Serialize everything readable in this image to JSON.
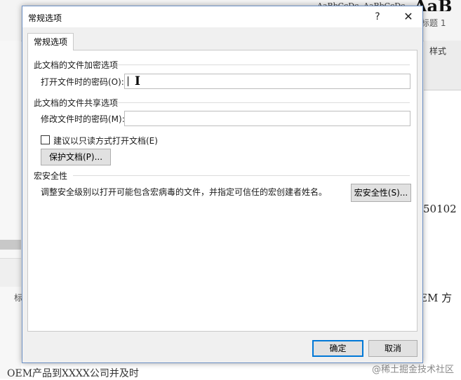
{
  "background": {
    "style_samples": [
      "AaBbCcDc",
      "AaBbCcDc",
      "AaB"
    ],
    "heading1": "标题 1",
    "styles_label": "样式",
    "doc_number": "50102",
    "doc_em_text": "EM 方",
    "left_label": "标",
    "bottom_text": "OEM产品到XXXX公司并及时",
    "watermark": "@稀土掘金技术社区"
  },
  "dialog": {
    "title": "常规选项",
    "help_glyph": "?",
    "close_glyph": "✕",
    "tab": "常规选项",
    "encrypt_section": "此文档的文件加密选项",
    "open_password_label": "打开文件时的密码(O):",
    "open_password_value": "",
    "share_section": "此文档的文件共享选项",
    "modify_password_label": "修改文件时的密码(M):",
    "modify_password_value": "",
    "readonly_checkbox_label": "建议以只读方式打开文档(E)",
    "readonly_checked": false,
    "protect_button": "保护文档(P)...",
    "macro_section": "宏安全性",
    "macro_description": "调整安全级别以打开可能包含宏病毒的文件，并指定可信任的宏创建者姓名。",
    "macro_button": "宏安全性(S)...",
    "ok_button": "确定",
    "cancel_button": "取消"
  },
  "colors": {
    "ok_border": "#0078d7",
    "dialog_border": "#6b8fc4"
  }
}
